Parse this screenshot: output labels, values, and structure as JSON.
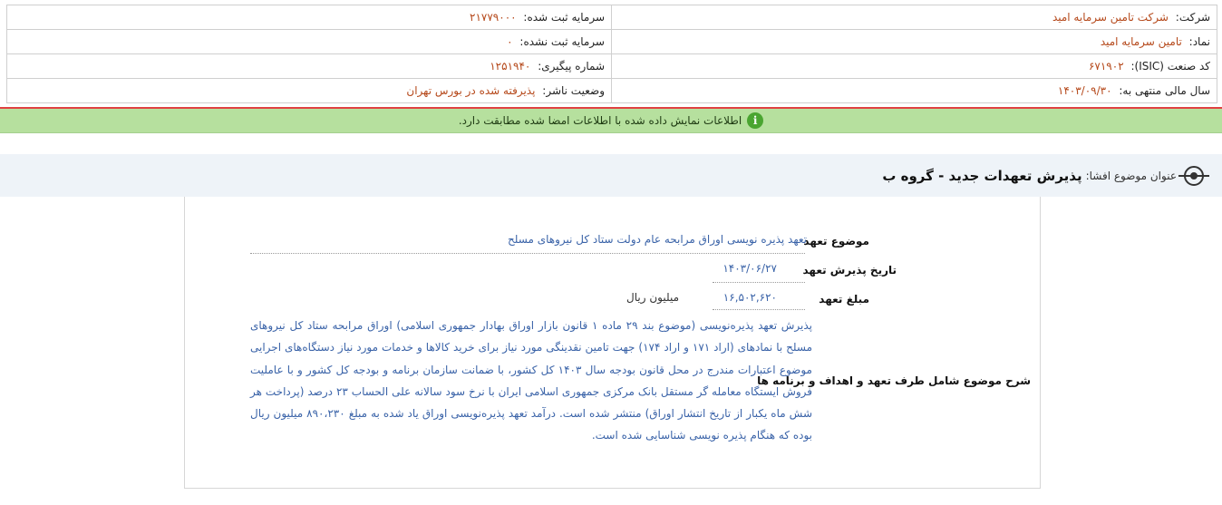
{
  "company_info": {
    "company": {
      "label": "شرکت:",
      "value": "شرکت تامین سرمایه امید"
    },
    "registered_capital": {
      "label": "سرمایه ثبت شده:",
      "value": "۲۱۷۷۹۰۰۰"
    },
    "symbol": {
      "label": "نماد:",
      "value": "تامین سرمایه امید"
    },
    "unregistered_capital": {
      "label": "سرمایه ثبت نشده:",
      "value": "۰"
    },
    "isic_code": {
      "label": "کد صنعت (ISIC):",
      "value": "۶۷۱۹۰۲"
    },
    "tracking_number": {
      "label": "شماره پیگیری:",
      "value": "۱۲۵۱۹۴۰"
    },
    "fiscal_year_end": {
      "label": "سال مالی منتهی به:",
      "value": "۱۴۰۳/۰۹/۳۰"
    },
    "publisher_status": {
      "label": "وضعیت ناشر:",
      "value": "پذیرفته شده در بورس تهران"
    }
  },
  "notice": {
    "icon": "info-icon",
    "text": "اطلاعات نمایش داده شده با اطلاعات امضا شده مطابقت دارد."
  },
  "title": {
    "icon": "target-icon",
    "prefix": "عنوان موضوع افشا:",
    "main": "پذیرش تعهدات جدید - گروه ب"
  },
  "commitment": {
    "subject": {
      "label": "موضوع تعهد",
      "value": "تعهد پذیره نویسی اوراق مرابحه عام دولت ستاد کل نیروهای مسلح"
    },
    "acceptance_date": {
      "label": "تاریخ پذیرش تعهد",
      "value": "۱۴۰۳/۰۶/۲۷"
    },
    "amount": {
      "label": "مبلغ تعهد",
      "value": "۱۶,۵۰۲,۶۲۰",
      "unit": "میلیون ریال"
    },
    "description": {
      "label": "شرح موضوع شامل طرف تعهد و اهداف و برنامه ها",
      "value": "پذیرش تعهد پذیره‌نویسی (موضوع بند ۲۹ ماده ۱ قانون بازار اوراق بهادار جمهوری اسلامی) اوراق مرابحه ستاد کل نیروهای مسلح با نمادهای (اراد ۱۷۱ و اراد ۱۷۴) جهت تامین نقدینگی مورد نیاز برای خرید کالاها و خدمات مورد نیاز دستگاه‌های اجرایی موضوع اعتبارات مندرج در محل قانون بودجه سال ۱۴۰۳ کل کشور، با ضمانت سازمان برنامه و بودجه کل کشور و با عاملیت فروش ایستگاه معامله گر مستقل بانک مرکزی جمهوری اسلامی ایران با نرخ سود سالانه علی الحساب ۲۳ درصد (پرداخت هر شش ماه یکبار از تاریخ انتشار اوراق) منتشر شده است. درآمد تعهد پذیره‌نویسی اوراق یاد شده به مبلغ ۸۹۰،۲۳۰ میلیون ریال بوده که هنگام پذیره نویسی شناسایی شده است."
    }
  }
}
